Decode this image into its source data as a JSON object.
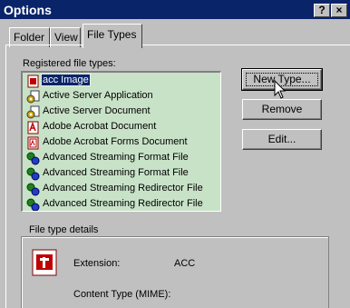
{
  "window": {
    "title": "Options",
    "help_btn": "?",
    "close_btn": "×"
  },
  "tabs": [
    {
      "label": "Folder"
    },
    {
      "label": "View"
    },
    {
      "label": "File Types"
    }
  ],
  "registered_label": "Registered file types:",
  "file_types": [
    {
      "label": "acc Image",
      "icon": "red-document-icon"
    },
    {
      "label": "Active Server Application",
      "icon": "asp-gear-icon"
    },
    {
      "label": "Active Server Document",
      "icon": "asp-gear-icon"
    },
    {
      "label": "Adobe Acrobat Document",
      "icon": "acrobat-icon"
    },
    {
      "label": "Adobe Acrobat Forms Document",
      "icon": "acrobat-forms-icon"
    },
    {
      "label": "Advanced Streaming Format File",
      "icon": "streaming-icon"
    },
    {
      "label": "Advanced Streaming Format File",
      "icon": "streaming-icon"
    },
    {
      "label": "Advanced Streaming Redirector File",
      "icon": "streaming-icon"
    },
    {
      "label": "Advanced Streaming Redirector File",
      "icon": "streaming-icon"
    }
  ],
  "buttons": {
    "new_type": "New Type...",
    "remove": "Remove",
    "edit": "Edit..."
  },
  "details": {
    "group_title": "File type details",
    "extension_label": "Extension:",
    "extension_value": "ACC",
    "content_type_label": "Content Type (MIME):"
  }
}
